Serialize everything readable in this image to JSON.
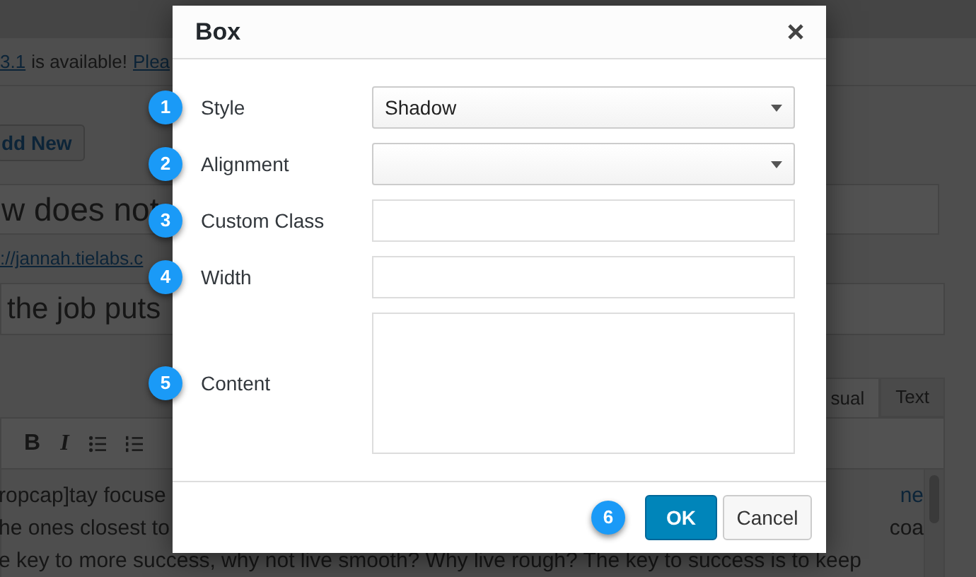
{
  "background": {
    "notice": {
      "version_link": "3.1",
      "text": "is available!",
      "update_link": "Plea"
    },
    "add_new_button": "dd New",
    "title_field": "w does not",
    "permalink": "://jannah.tielabs.c",
    "second_field": "the job puts",
    "editor_tabs": [
      {
        "label": "sual",
        "selected": true
      },
      {
        "label": "Text",
        "selected": false
      }
    ],
    "toolbar": [
      "B",
      "I"
    ],
    "content_lines": [
      {
        "left": "ropcap]tay focuse",
        "right": {
          "text": "ne",
          "kind": "link"
        }
      },
      {
        "left": "he ones closest to",
        "right": {
          "text": "coa",
          "kind": "text"
        }
      },
      {
        "left": "e key to more success, why not live smooth? Why live rough? The key to success is to keep"
      }
    ]
  },
  "dialog": {
    "title": "Box",
    "fields": [
      {
        "badge": "1",
        "label": "Style",
        "kind": "select",
        "value": "Shadow"
      },
      {
        "badge": "2",
        "label": "Alignment",
        "kind": "select"
      },
      {
        "badge": "3",
        "label": "Custom Class",
        "kind": "text"
      },
      {
        "badge": "4",
        "label": "Width",
        "kind": "text"
      },
      {
        "badge": "5",
        "label": "Content",
        "kind": "textarea"
      }
    ],
    "footer_badge": "6",
    "buttons": [
      {
        "label": "OK",
        "kind": "primary"
      },
      {
        "label": "Cancel",
        "kind": "secondary"
      }
    ]
  }
}
